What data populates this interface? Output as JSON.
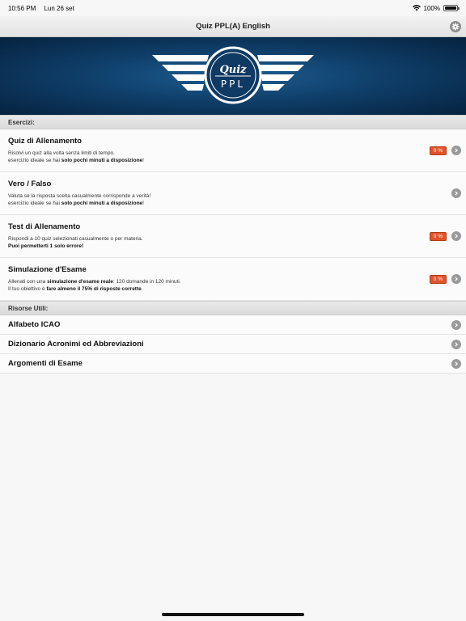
{
  "status_bar": {
    "time": "10:56 PM",
    "date": "Lun 26 set",
    "battery": "100%"
  },
  "nav": {
    "title": "Quiz PPL(A) English",
    "settings_icon": "gear-icon"
  },
  "banner": {
    "logo_top": "Quiz",
    "logo_bottom": "PPL"
  },
  "sections": {
    "exercises": "Esercizi:",
    "resources": "Risorse Utili:"
  },
  "exercises": [
    {
      "title": "Quiz di Allenamento",
      "line1": "Risolvi un quiz alla volta senza limiti di tempo.",
      "line2_pre": "esercizio ideale se hai ",
      "line2_bold": "solo pochi minuti a disposizione",
      "line2_post": "!",
      "badge": "0 %"
    },
    {
      "title": "Vero / Falso",
      "line1": "Valuta se la risposta scelta casualmente corrisponde a verità!",
      "line2_pre": "esercizio ideale se hai ",
      "line2_bold": "solo pochi minuti a disposizione",
      "line2_post": "!"
    },
    {
      "title": "Test di Allenamento",
      "line1": "Rispondi a 10 quiz selezionati casualmente o per materia.",
      "line2_bold": "Puoi permetterti 1 solo errore!",
      "badge": "0 %"
    },
    {
      "title": "Simulazione d'Esame",
      "line1_pre": "Allenati con una ",
      "line1_bold": "simulazione d'esame reale",
      "line1_post": ": 120 domande in 120 minuti.",
      "line2_pre": "Il tuo obiettivo è ",
      "line2_bold": "fare almeno il 75% di risposte corrette",
      "line2_post": ".",
      "badge": "0 %"
    }
  ],
  "resources": [
    {
      "title": "Alfabeto ICAO"
    },
    {
      "title": "Dizionario Acronimi ed Abbreviazioni"
    },
    {
      "title": "Argomenti di Esame"
    }
  ],
  "colors": {
    "badge": "#e0542a",
    "banner": "#0f3f6a"
  }
}
